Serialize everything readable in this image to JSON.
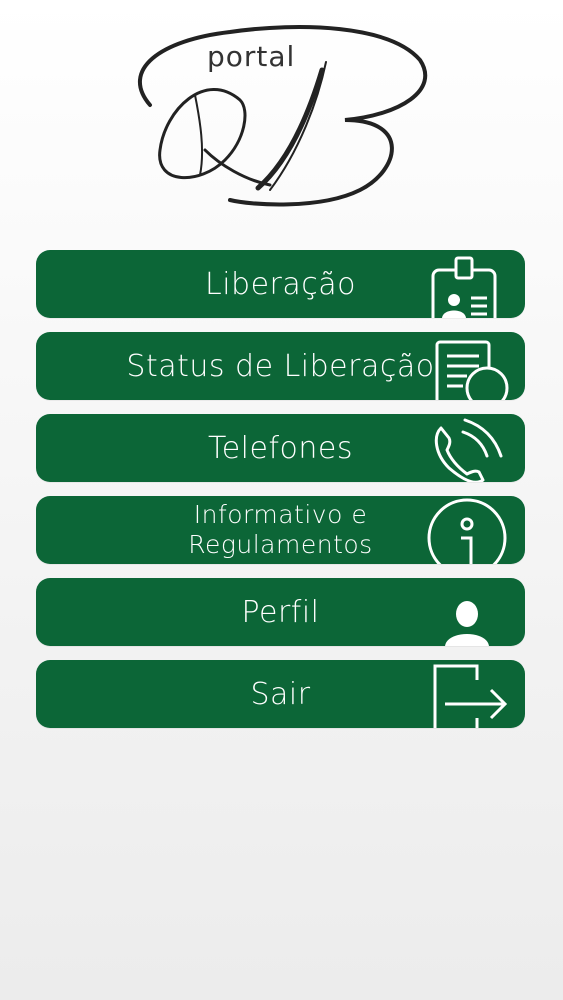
{
  "logo": {
    "text": "portal"
  },
  "menu": [
    {
      "label": "Liberação",
      "icon": "id-badge-icon"
    },
    {
      "label": "Status de Liberação",
      "icon": "document-user-icon"
    },
    {
      "label": "Telefones",
      "icon": "phone-icon"
    },
    {
      "label": "Informativo e\nRegulamentos",
      "icon": "info-icon"
    },
    {
      "label": "Perfil",
      "icon": "user-icon"
    },
    {
      "label": "Sair",
      "icon": "exit-icon"
    }
  ],
  "colors": {
    "button": "#0c6637",
    "text": "#ffffff"
  }
}
